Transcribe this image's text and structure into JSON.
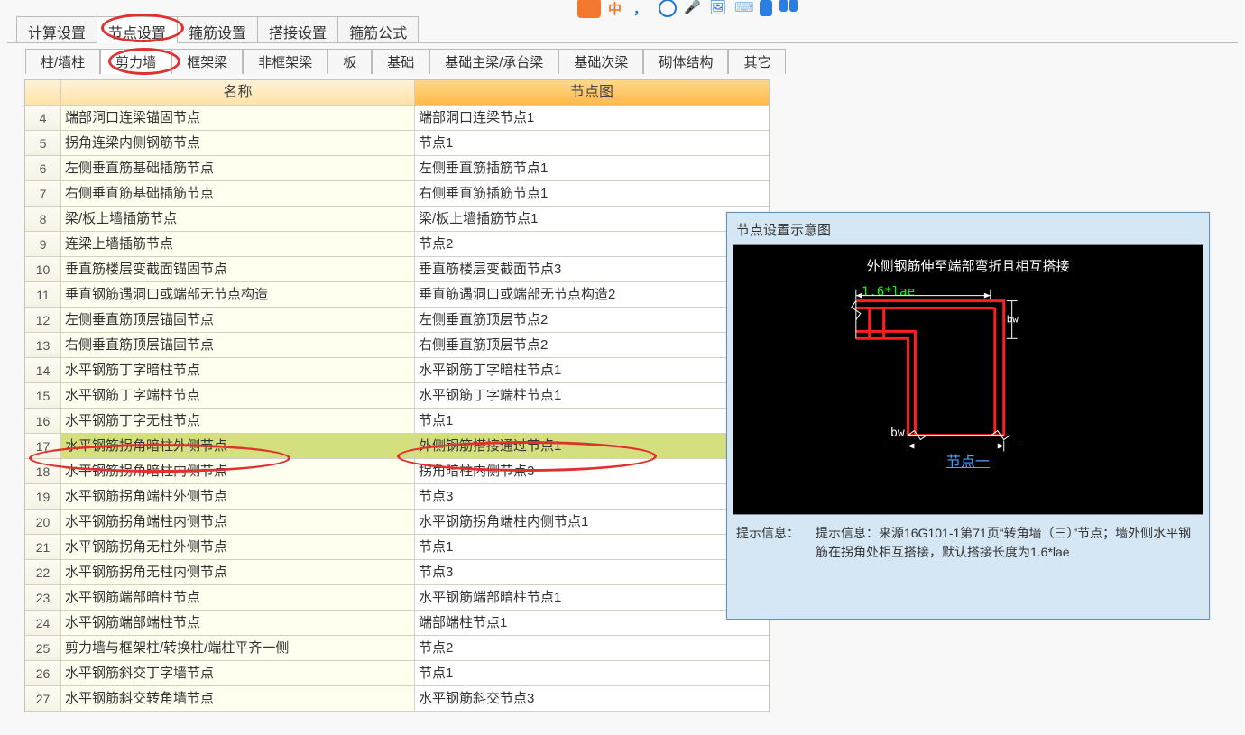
{
  "top_icons": {
    "orange": "#f4772e",
    "blue": "#1f78d6",
    "lightblue": "#5aa8e8"
  },
  "settings_tabs": [
    "计算设置",
    "节点设置",
    "箍筋设置",
    "搭接设置",
    "箍筋公式"
  ],
  "settings_active_index": 1,
  "category_tabs": [
    "柱/墙柱",
    "剪力墙",
    "框架梁",
    "非框架梁",
    "板",
    "基础",
    "基础主梁/承台梁",
    "基础次梁",
    "砌体结构",
    "其它"
  ],
  "category_active_index": 1,
  "table": {
    "header_name": "名称",
    "header_diagram": "节点图",
    "rows": [
      {
        "n": 4,
        "name": "端部洞口连梁锚固节点",
        "diagram": "端部洞口连梁节点1"
      },
      {
        "n": 5,
        "name": "拐角连梁内侧钢筋节点",
        "diagram": "节点1"
      },
      {
        "n": 6,
        "name": "左侧垂直筋基础插筋节点",
        "diagram": "左侧垂直筋插筋节点1"
      },
      {
        "n": 7,
        "name": "右侧垂直筋基础插筋节点",
        "diagram": "右侧垂直筋插筋节点1"
      },
      {
        "n": 8,
        "name": "梁/板上墙插筋节点",
        "diagram": "梁/板上墙插筋节点1"
      },
      {
        "n": 9,
        "name": "连梁上墙插筋节点",
        "diagram": "节点2"
      },
      {
        "n": 10,
        "name": "垂直筋楼层变截面锚固节点",
        "diagram": "垂直筋楼层变截面节点3"
      },
      {
        "n": 11,
        "name": "垂直钢筋遇洞口或端部无节点构造",
        "diagram": "垂直筋遇洞口或端部无节点构造2"
      },
      {
        "n": 12,
        "name": "左侧垂直筋顶层锚固节点",
        "diagram": "左侧垂直筋顶层节点2"
      },
      {
        "n": 13,
        "name": "右侧垂直筋顶层锚固节点",
        "diagram": "右侧垂直筋顶层节点2"
      },
      {
        "n": 14,
        "name": "水平钢筋丁字暗柱节点",
        "diagram": "水平钢筋丁字暗柱节点1"
      },
      {
        "n": 15,
        "name": "水平钢筋丁字端柱节点",
        "diagram": "水平钢筋丁字端柱节点1"
      },
      {
        "n": 16,
        "name": "水平钢筋丁字无柱节点",
        "diagram": "节点1"
      },
      {
        "n": 17,
        "name": "水平钢筋拐角暗柱外侧节点",
        "diagram": "外侧钢筋搭接通过节点1",
        "selected": true
      },
      {
        "n": 18,
        "name": "水平钢筋拐角暗柱内侧节点",
        "diagram": "拐角暗柱内侧节点3"
      },
      {
        "n": 19,
        "name": "水平钢筋拐角端柱外侧节点",
        "diagram": "节点3"
      },
      {
        "n": 20,
        "name": "水平钢筋拐角端柱内侧节点",
        "diagram": "水平钢筋拐角端柱内侧节点1"
      },
      {
        "n": 21,
        "name": "水平钢筋拐角无柱外侧节点",
        "diagram": "节点1"
      },
      {
        "n": 22,
        "name": "水平钢筋拐角无柱内侧节点",
        "diagram": "节点3"
      },
      {
        "n": 23,
        "name": "水平钢筋端部暗柱节点",
        "diagram": "水平钢筋端部暗柱节点1"
      },
      {
        "n": 24,
        "name": "水平钢筋端部端柱节点",
        "diagram": "端部端柱节点1"
      },
      {
        "n": 25,
        "name": "剪力墙与框架柱/转换柱/端柱平齐一侧",
        "diagram": "节点2"
      },
      {
        "n": 26,
        "name": "水平钢筋斜交丁字墙节点",
        "diagram": "节点1"
      },
      {
        "n": 27,
        "name": "水平钢筋斜交转角墙节点",
        "diagram": "水平钢筋斜交节点3"
      }
    ]
  },
  "preview": {
    "title": "节点设置示意图",
    "caption": "外侧钢筋伸至端部弯折且相互搭接",
    "lae_label": "1.6*lae",
    "bw_label": "bw",
    "link_text": "节点一",
    "hint_label": "提示信息：",
    "hint_body": "提示信息：来源16G101-1第71页“转角墙（三）”节点；墙外侧水平钢筋在拐角处相互搭接，默认搭接长度为1.6*lae"
  }
}
